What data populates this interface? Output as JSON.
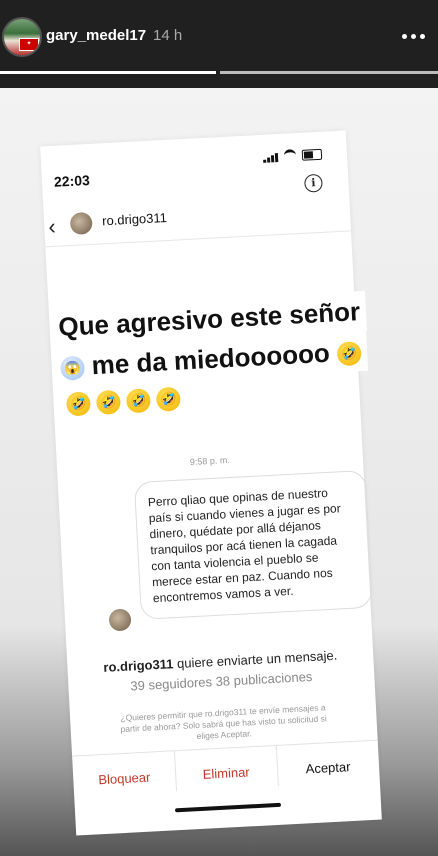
{
  "story": {
    "username": "gary_medel17",
    "time_ago": "14 h"
  },
  "screenshot": {
    "status_time": "22:03",
    "chat_username": "ro.drigo311",
    "message_time": "9:58 p. m.",
    "message_text": "Perro qliao que opinas de nuestro país si cuando vienes a jugar es por dinero, quédate por allá déjanos tranquilos por acá tienen la cagada con tanta violencia el pueblo se merece estar en paz. Cuando nos encontremos vamos a ver.",
    "request_user": "ro.drigo311",
    "request_suffix": " quiere enviarte un mensaje.",
    "request_stats": "39 seguidores 38 publicaciones",
    "request_note": "¿Quieres permitir que ro.drigo311 te envíe mensajes a partir de ahora? Solo sabrá que has visto tu solicitud si eliges Aceptar.",
    "actions": {
      "block": "Bloquear",
      "delete": "Eliminar",
      "accept": "Aceptar"
    }
  },
  "caption": {
    "line1": "Que agresivo este señor",
    "line2": "me da miedoooooo"
  },
  "icons": [
    "back-icon",
    "info-icon",
    "more-options-icon",
    "signal-icon",
    "wifi-icon",
    "battery-icon",
    "laughing-emoji",
    "screaming-emoji"
  ],
  "colors": {
    "destructive": "#c0392b",
    "story_bg": "#1a1a1a"
  }
}
